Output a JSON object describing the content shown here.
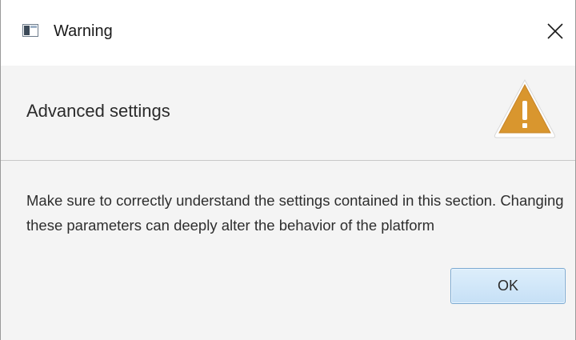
{
  "window": {
    "title": "Warning",
    "app_icon": "window-app-icon",
    "close_icon": "close-icon"
  },
  "header": {
    "title": "Advanced settings",
    "icon": "warning-icon",
    "icon_color": "#d9962e"
  },
  "content": {
    "message": "Make sure to correctly understand the settings contained in this section. Changing these parameters can deeply alter the behavior of the platform"
  },
  "buttons": {
    "ok_label": "OK"
  },
  "colors": {
    "button_border": "#7aa9d1",
    "button_fill": "#cfe6f8",
    "background": "#f4f4f4"
  }
}
